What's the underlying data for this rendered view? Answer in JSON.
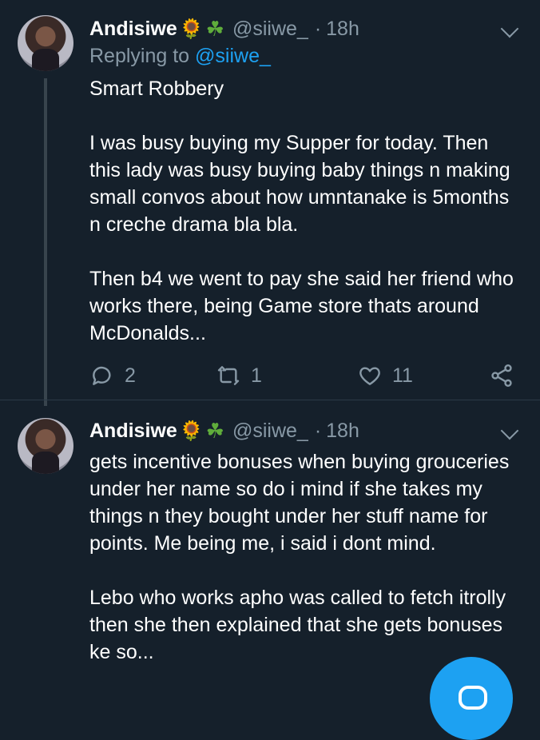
{
  "tweets": [
    {
      "name": "Andisiwe",
      "emoji1": "🌻",
      "emoji2": "☘",
      "handle": "@siiwe_",
      "dot": "·",
      "time": "18h",
      "replying_prefix": "Replying to",
      "replying_to": "@siiwe_",
      "paragraphs": [
        "Smart Robbery",
        "I was busy buying  my Supper for today. Then this lady was busy buying baby things n making small convos  about how umntanake is 5months n creche drama bla bla.",
        "Then b4 we went to pay she said her friend who works there, being Game store thats around McDonalds..."
      ],
      "counts": {
        "replies": "2",
        "retweets": "1",
        "likes": "11"
      }
    },
    {
      "name": "Andisiwe",
      "emoji1": "🌻",
      "emoji2": "☘",
      "handle": "@siiwe_",
      "dot": "·",
      "time": "18h",
      "paragraphs": [
        "gets incentive bonuses when buying grouceries under her name so do i mind if she takes my things n they bought under her stuff name for points. Me being me, i said i dont mind.",
        "Lebo who works apho was called to fetch itrolly then she then explained that she gets bonuses ke so..."
      ]
    }
  ],
  "icons": {
    "reply": "reply-icon",
    "retweet": "retweet-icon",
    "like": "heart-icon",
    "share": "share-icon",
    "more": "chevron-down-icon",
    "compose": "compose-icon"
  },
  "colors": {
    "background": "#15202b",
    "secondary_text": "#8899a6",
    "link": "#1da1f2",
    "fab": "#1da1f2"
  }
}
